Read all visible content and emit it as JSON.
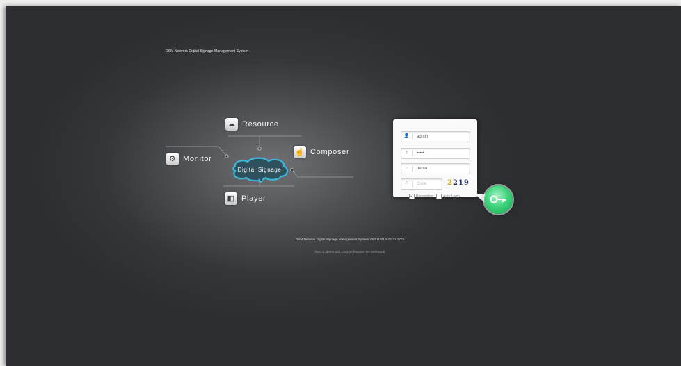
{
  "app": {
    "title": "DSM Network Digital Signage Management System"
  },
  "mind_map": {
    "center": {
      "label": "Digital Signage"
    },
    "modules": [
      {
        "label": "Resource",
        "icon": "cloud-upload-icon"
      },
      {
        "label": "Monitor",
        "icon": "gear-icon"
      },
      {
        "label": "Composer",
        "icon": "hand-pointer-icon"
      },
      {
        "label": "Player",
        "icon": "grid-squares-icon"
      }
    ]
  },
  "login": {
    "username": {
      "value": "admin",
      "icon": "user-icon"
    },
    "password": {
      "value": "•••••",
      "icon": "key-icon"
    },
    "domain": {
      "value": "demo",
      "icon": "domain-icon"
    },
    "code": {
      "placeholder": "Code",
      "icon": "code-icon"
    },
    "captcha": {
      "chars": [
        "2",
        "2",
        "1",
        "9"
      ]
    },
    "remember": {
      "label": "Remember",
      "checked": true
    },
    "auto_login": {
      "label": "Auto Login",
      "checked": false
    },
    "login_button": {
      "icon": "key-icon",
      "color": "#3fd37c"
    }
  },
  "footer": {
    "version": "DSM Network Digital Signage Management System V5.5 B201.5.01.21.1703",
    "browser_note": "(IE8 or above and Chrome browser are preferred)"
  }
}
